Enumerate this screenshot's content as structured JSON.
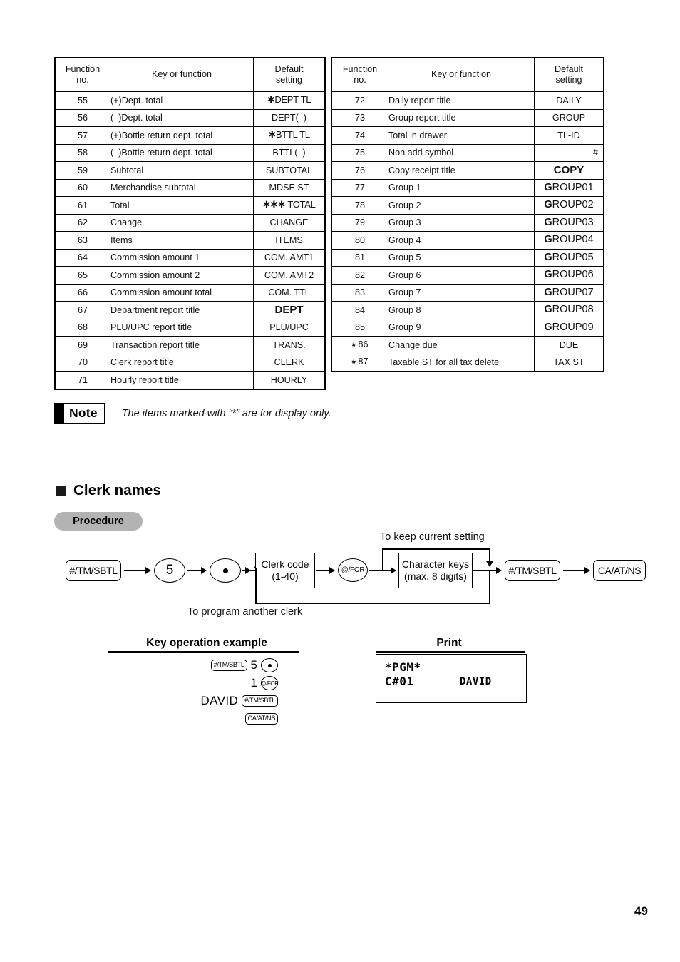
{
  "tables": {
    "headers": [
      "Function no.",
      "Key or function",
      "Default setting"
    ],
    "header_lines": [
      [
        "Function",
        "no."
      ],
      [
        "Key or function"
      ],
      [
        "Default",
        "setting"
      ]
    ],
    "left_rows": [
      {
        "no": "55",
        "star": false,
        "key": "(+)Dept. total",
        "def": "✱DEPT TL",
        "style": "ast"
      },
      {
        "no": "56",
        "star": false,
        "key": "(–)Dept. total",
        "def": "DEPT(–)",
        "style": "plain"
      },
      {
        "no": "57",
        "star": false,
        "key": "(+)Bottle return dept. total",
        "def": "✱BTTL TL",
        "style": "ast"
      },
      {
        "no": "58",
        "star": false,
        "key": "(–)Bottle return dept. total",
        "def": "BTTL(–)",
        "style": "plain"
      },
      {
        "no": "59",
        "star": false,
        "key": "Subtotal",
        "def": "SUBTOTAL",
        "style": "plain"
      },
      {
        "no": "60",
        "star": false,
        "key": "Merchandise subtotal",
        "def": "MDSE ST",
        "style": "plain"
      },
      {
        "no": "61",
        "star": false,
        "key": "Total",
        "def": "✱✱✱ TOTAL",
        "style": "ast"
      },
      {
        "no": "62",
        "star": false,
        "key": "Change",
        "def": "CHANGE",
        "style": "plain"
      },
      {
        "no": "63",
        "star": false,
        "key": "Items",
        "def": "ITEMS",
        "style": "plain"
      },
      {
        "no": "64",
        "star": false,
        "key": "Commission amount 1",
        "def": "COM. AMT1",
        "style": "plain"
      },
      {
        "no": "65",
        "star": false,
        "key": "Commission amount 2",
        "def": "COM. AMT2",
        "style": "plain"
      },
      {
        "no": "66",
        "star": false,
        "key": "Commission amount total",
        "def": "COM. TTL",
        "style": "plain"
      },
      {
        "no": "67",
        "star": false,
        "key": "Department report title",
        "def": "DEPT",
        "style": "bold"
      },
      {
        "no": "68",
        "star": false,
        "key": "PLU/UPC report title",
        "def": "PLU/UPC",
        "style": "plain"
      },
      {
        "no": "69",
        "star": false,
        "key": "Transaction report title",
        "def": "TRANS.",
        "style": "plain"
      },
      {
        "no": "70",
        "star": false,
        "key": "Clerk report title",
        "def": "CLERK",
        "style": "plain"
      },
      {
        "no": "71",
        "star": false,
        "key": "Hourly report title",
        "def": "HOURLY",
        "style": "plain"
      }
    ],
    "right_rows": [
      {
        "no": "72",
        "star": false,
        "key": "Daily report title",
        "def": "DAILY",
        "style": "plain"
      },
      {
        "no": "73",
        "star": false,
        "key": "Group report title",
        "def": "GROUP",
        "style": "plain"
      },
      {
        "no": "74",
        "star": false,
        "key": "Total in drawer",
        "def": "TL-ID",
        "style": "plain"
      },
      {
        "no": "75",
        "star": false,
        "key": "Non add symbol",
        "def": "#",
        "style": "hash"
      },
      {
        "no": "76",
        "star": false,
        "key": "Copy receipt title",
        "def": "COPY",
        "style": "bold"
      },
      {
        "no": "77",
        "star": false,
        "key": "Group 1",
        "def": "GROUP01",
        "style": "group"
      },
      {
        "no": "78",
        "star": false,
        "key": "Group 2",
        "def": "GROUP02",
        "style": "group"
      },
      {
        "no": "79",
        "star": false,
        "key": "Group 3",
        "def": "GROUP03",
        "style": "group"
      },
      {
        "no": "80",
        "star": false,
        "key": "Group 4",
        "def": "GROUP04",
        "style": "group"
      },
      {
        "no": "81",
        "star": false,
        "key": "Group 5",
        "def": "GROUP05",
        "style": "group"
      },
      {
        "no": "82",
        "star": false,
        "key": "Group 6",
        "def": "GROUP06",
        "style": "group"
      },
      {
        "no": "83",
        "star": false,
        "key": "Group 7",
        "def": "GROUP07",
        "style": "group"
      },
      {
        "no": "84",
        "star": false,
        "key": "Group 8",
        "def": "GROUP08",
        "style": "group"
      },
      {
        "no": "85",
        "star": false,
        "key": "Group 9",
        "def": "GROUP09",
        "style": "group"
      },
      {
        "no": "86",
        "star": true,
        "key": "Change due",
        "def": "DUE",
        "style": "plain"
      },
      {
        "no": "87",
        "star": true,
        "key": "Taxable ST for all tax delete",
        "def": "TAX ST",
        "style": "plain"
      }
    ]
  },
  "note": {
    "label": "Note",
    "text": "The items marked with “*” are for display only."
  },
  "section": {
    "heading": "Clerk names",
    "procedure_label": "Procedure"
  },
  "flow": {
    "nodes": {
      "key_tmsbtl_1": "#/TM/SBTL",
      "five": "5",
      "dot": "•",
      "clerk_code_l1": "Clerk code",
      "clerk_code_l2": "(1-40)",
      "at_for": "@/FOR",
      "char_keys_l1": "Character keys",
      "char_keys_l2": "(max. 8 digits)",
      "key_tmsbtl_2": "#/TM/SBTL",
      "key_ca_at_ns": "CA/AT/NS"
    },
    "labels": {
      "keep_current": "To keep current setting",
      "program_another": "To program another clerk"
    }
  },
  "example": {
    "heading": "Key operation example",
    "lines": [
      {
        "items": [
          {
            "type": "keycap",
            "text": "#/TM/SBTL"
          },
          {
            "type": "num",
            "text": "5"
          },
          {
            "type": "dotkey",
            "text": "•"
          }
        ]
      },
      {
        "items": [
          {
            "type": "num",
            "text": "1"
          },
          {
            "type": "circkey",
            "text": "@/FOR"
          }
        ]
      },
      {
        "items": [
          {
            "type": "text",
            "text": "DAVID"
          },
          {
            "type": "keycap",
            "text": "#/TM/SBTL"
          }
        ]
      },
      {
        "items": [
          {
            "type": "keycap",
            "text": "CA/AT/NS"
          }
        ]
      }
    ]
  },
  "print": {
    "heading": "Print",
    "receipt": {
      "title": "*PGM*",
      "clerk_code": "C#01",
      "clerk_name": "DAVID"
    }
  },
  "page": {
    "number": "49"
  }
}
